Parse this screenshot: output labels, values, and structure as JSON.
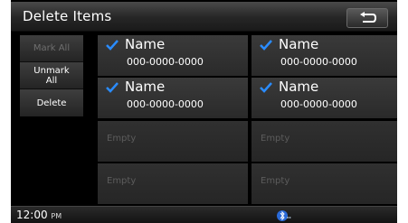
{
  "header": {
    "title": "Delete Items"
  },
  "sidebar": {
    "mark_all": "Mark All",
    "unmark_all": "Unmark\nAll",
    "delete": "Delete"
  },
  "items": [
    {
      "name": "Name",
      "number": "000-0000-0000",
      "checked": true
    },
    {
      "name": "Name",
      "number": "000-0000-0000",
      "checked": true
    },
    {
      "name": "Name",
      "number": "000-0000-0000",
      "checked": true
    },
    {
      "name": "Name",
      "number": "000-0000-0000",
      "checked": true
    },
    {
      "label": "Empty"
    },
    {
      "label": "Empty"
    },
    {
      "label": "Empty"
    },
    {
      "label": "Empty"
    }
  ],
  "status": {
    "time": "12:00",
    "ampm": "PM",
    "icon": "bluetooth-icon"
  },
  "colors": {
    "check": "#2a8cff",
    "background": "#000000",
    "disabled_text": "#6f6f6f"
  }
}
